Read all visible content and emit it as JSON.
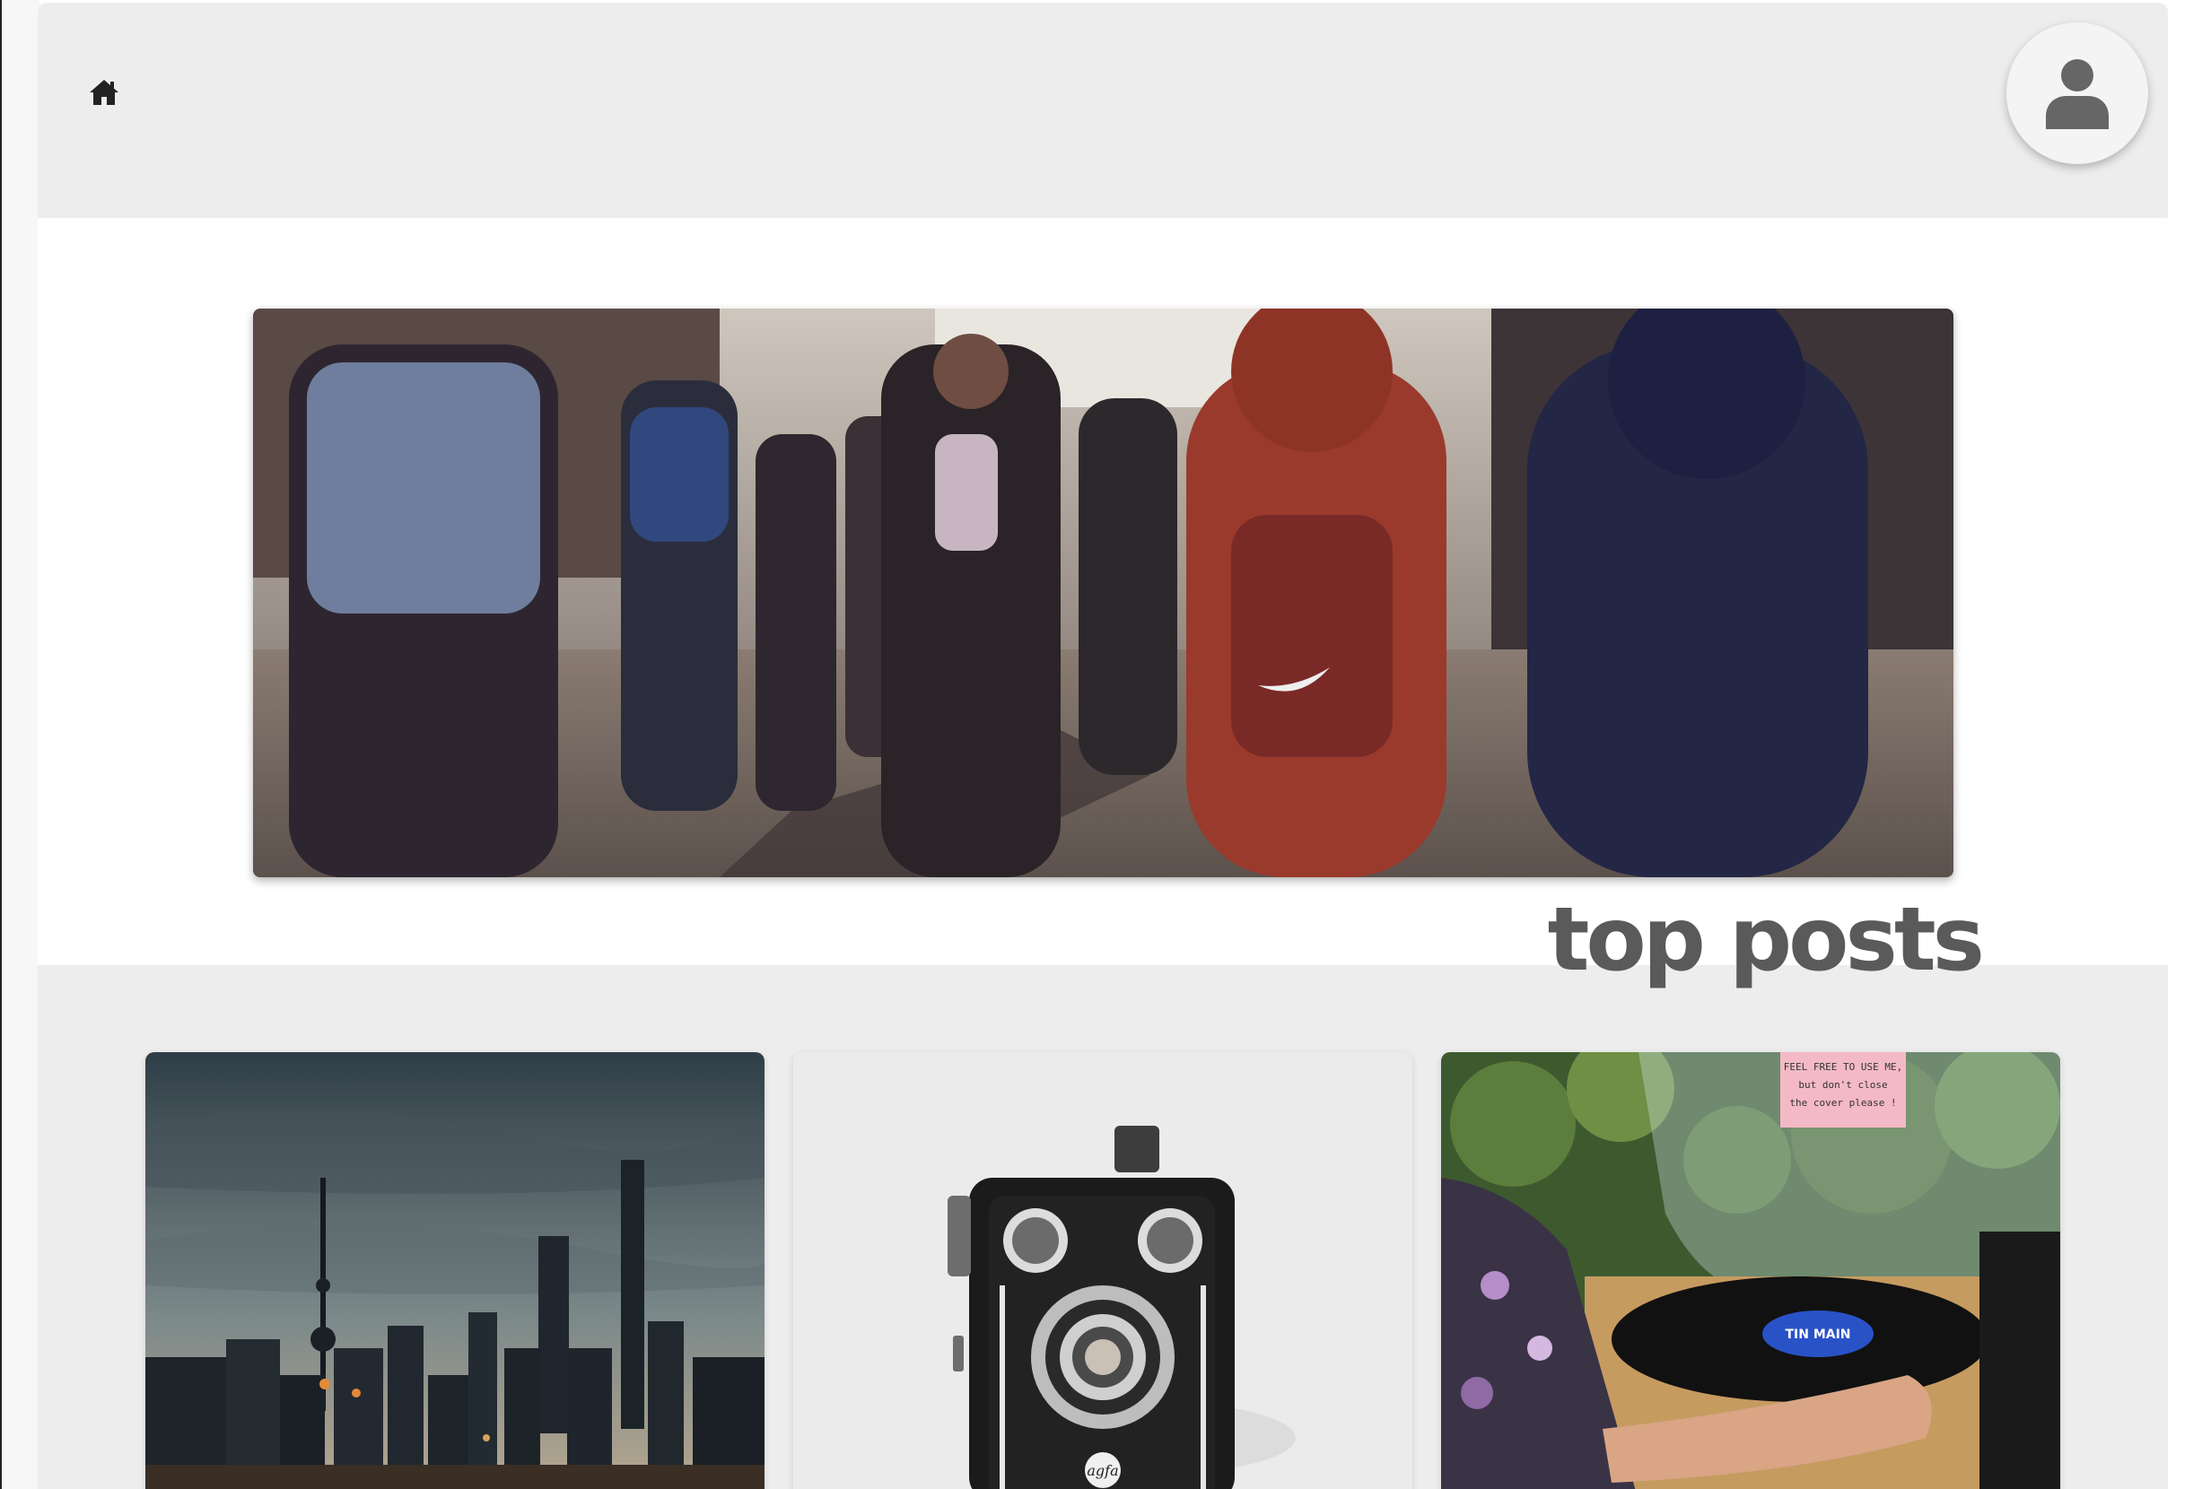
{
  "header": {
    "home_icon": "home-icon",
    "avatar_icon": "user-icon"
  },
  "hero": {
    "image": "city-street-crowd-photo"
  },
  "top_posts": {
    "title": "top posts",
    "posts": [
      {
        "image": "city-skyline-night-photo"
      },
      {
        "image": "vintage-box-camera-photo",
        "lens_text": "agfa"
      },
      {
        "image": "record-turntable-photo",
        "record_label": "TIN MAIN",
        "sticker_lines": [
          "FEEL FREE TO USE ME,",
          "but don't close",
          "the cover please !"
        ]
      }
    ]
  },
  "colors": {
    "header_bg": "#ededed",
    "title": "#5a5a5a",
    "icon": "#222222",
    "avatar_icon": "#666666"
  }
}
